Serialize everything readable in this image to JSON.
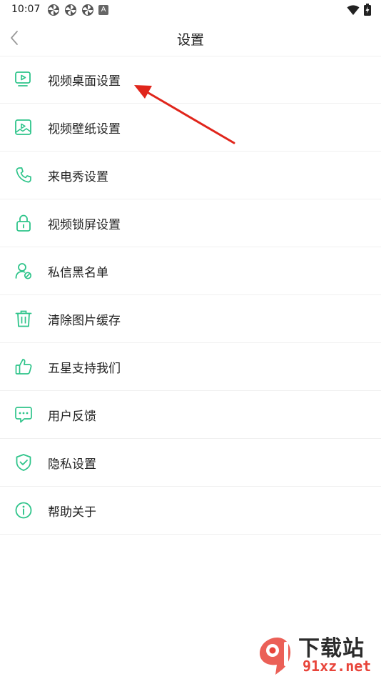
{
  "status_bar": {
    "time": "10:07",
    "badge": "A"
  },
  "header": {
    "title": "设置",
    "back_icon": "chevron-left-icon"
  },
  "menu": {
    "items": [
      {
        "label": "视频桌面设置",
        "icon": "video-desktop-icon"
      },
      {
        "label": "视频壁纸设置",
        "icon": "wallpaper-icon"
      },
      {
        "label": "来电秀设置",
        "icon": "phone-icon"
      },
      {
        "label": "视频锁屏设置",
        "icon": "lock-icon"
      },
      {
        "label": "私信黑名单",
        "icon": "user-blocked-icon"
      },
      {
        "label": "清除图片缓存",
        "icon": "trash-icon"
      },
      {
        "label": "五星支持我们",
        "icon": "thumbs-up-icon"
      },
      {
        "label": "用户反馈",
        "icon": "chat-bubble-icon"
      },
      {
        "label": "隐私设置",
        "icon": "shield-check-icon"
      },
      {
        "label": "帮助关于",
        "icon": "info-icon"
      }
    ]
  },
  "watermark": {
    "title": "下载站",
    "domain": "91xz.net"
  },
  "colors": {
    "accent": "#2ec48a",
    "arrow": "#e0251b",
    "text": "#222222",
    "divider": "#f0f0f0"
  }
}
